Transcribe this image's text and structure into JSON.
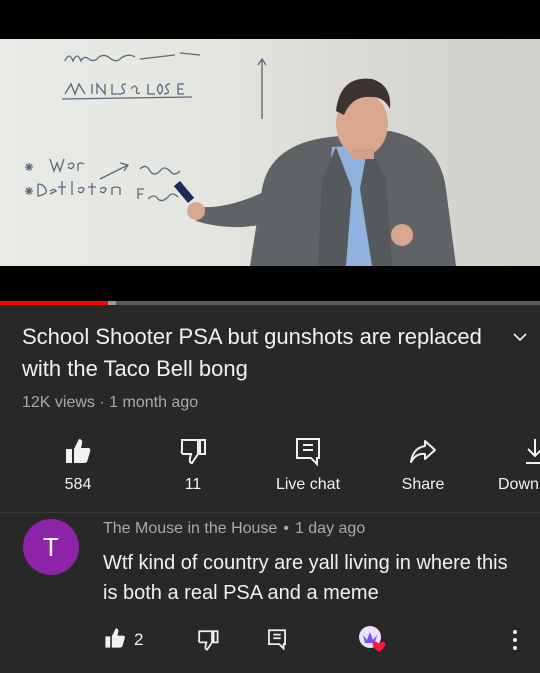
{
  "video": {
    "title": "School Shooter PSA but gunshots are replaced with the Taco Bell bong",
    "views": "12K views",
    "age": "1 month ago",
    "progress_fraction": 0.2,
    "buffered_fraction": 0.215
  },
  "actions": {
    "like_count": "584",
    "dislike_count": "11",
    "live_chat_label": "Live chat",
    "share_label": "Share",
    "download_label": "Down"
  },
  "comment": {
    "avatar_letter": "T",
    "author": "The Mouse in the House",
    "time": "1 day ago",
    "text": "Wtf kind of country are yall living in where this is both a real PSA and a meme",
    "like_count": "2"
  },
  "colors": {
    "background": "#282828",
    "progress": "#ff0000",
    "avatar": "#8e24aa"
  }
}
